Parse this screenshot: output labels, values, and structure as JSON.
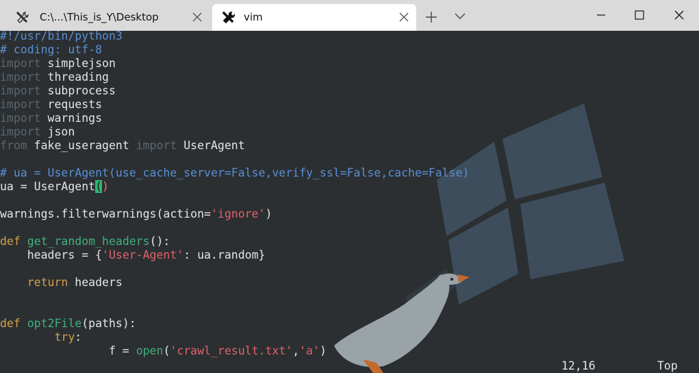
{
  "window": {
    "tabs": [
      {
        "label": "C:\\...\\This_is_Y\\Desktop",
        "icon": "tools-icon",
        "active": false
      },
      {
        "label": "vim",
        "icon": "tools-icon",
        "active": true
      }
    ]
  },
  "editor": {
    "lines": [
      {
        "parts": [
          {
            "t": "#!/usr/bin/python3",
            "c": "comment"
          }
        ]
      },
      {
        "parts": [
          {
            "t": "# coding: utf-8",
            "c": "comment"
          }
        ]
      },
      {
        "parts": [
          {
            "t": "import",
            "c": "kw"
          },
          {
            "t": " simplejson",
            "c": "op"
          }
        ]
      },
      {
        "parts": [
          {
            "t": "import",
            "c": "kw"
          },
          {
            "t": " threading",
            "c": "op"
          }
        ]
      },
      {
        "parts": [
          {
            "t": "import",
            "c": "kw"
          },
          {
            "t": " subprocess",
            "c": "op"
          }
        ]
      },
      {
        "parts": [
          {
            "t": "import",
            "c": "kw"
          },
          {
            "t": " requests",
            "c": "op"
          }
        ]
      },
      {
        "parts": [
          {
            "t": "import",
            "c": "kw"
          },
          {
            "t": " warnings",
            "c": "op"
          }
        ]
      },
      {
        "parts": [
          {
            "t": "import",
            "c": "kw"
          },
          {
            "t": " json",
            "c": "op"
          }
        ]
      },
      {
        "parts": [
          {
            "t": "from",
            "c": "kw"
          },
          {
            "t": " fake_useragent ",
            "c": "op"
          },
          {
            "t": "import",
            "c": "kw"
          },
          {
            "t": " UserAgent",
            "c": "op"
          }
        ]
      },
      {
        "parts": []
      },
      {
        "parts": [
          {
            "t": "# ua = UserAgent(use_cache_server=False,verify_ssl=False,cache=False)",
            "c": "comment"
          }
        ]
      },
      {
        "parts": [
          {
            "t": "ua = UserAgent",
            "c": "op"
          },
          {
            "t": "(",
            "c": "paren-hl"
          },
          {
            "t": ")",
            "c": "paren-hl2"
          }
        ]
      },
      {
        "parts": []
      },
      {
        "parts": [
          {
            "t": "warnings.filterwarnings(action=",
            "c": "op"
          },
          {
            "t": "'ignore'",
            "c": "str"
          },
          {
            "t": ")",
            "c": "op"
          }
        ]
      },
      {
        "parts": []
      },
      {
        "parts": [
          {
            "t": "def",
            "c": "kw2"
          },
          {
            "t": " ",
            "c": "op"
          },
          {
            "t": "get_random_headers",
            "c": "fn"
          },
          {
            "t": "():",
            "c": "op"
          }
        ]
      },
      {
        "parts": [
          {
            "t": "    headers = {",
            "c": "op"
          },
          {
            "t": "'User-Agent'",
            "c": "str"
          },
          {
            "t": ": ua.random}",
            "c": "op"
          }
        ]
      },
      {
        "parts": []
      },
      {
        "parts": [
          {
            "t": "    ",
            "c": "op"
          },
          {
            "t": "return",
            "c": "kw2"
          },
          {
            "t": " headers",
            "c": "op"
          }
        ]
      },
      {
        "parts": []
      },
      {
        "parts": []
      },
      {
        "parts": [
          {
            "t": "def",
            "c": "kw2"
          },
          {
            "t": " ",
            "c": "op"
          },
          {
            "t": "opt2File",
            "c": "fn"
          },
          {
            "t": "(paths):",
            "c": "op"
          }
        ]
      },
      {
        "parts": [
          {
            "t": "        ",
            "c": "op"
          },
          {
            "t": "try",
            "c": "kw2"
          },
          {
            "t": ":",
            "c": "op"
          }
        ]
      },
      {
        "parts": [
          {
            "t": "                f = ",
            "c": "op"
          },
          {
            "t": "open",
            "c": "fn"
          },
          {
            "t": "(",
            "c": "op"
          },
          {
            "t": "'crawl_result.txt'",
            "c": "str"
          },
          {
            "t": ",",
            "c": "op"
          },
          {
            "t": "'a'",
            "c": "str"
          },
          {
            "t": ")",
            "c": "op"
          }
        ]
      }
    ]
  },
  "status": {
    "position": "12,16",
    "scroll": "Top"
  },
  "colors": {
    "background": "#2b2f31",
    "comment": "#5b8fd6",
    "keyword": "#5b6670",
    "statement": "#d4a14a",
    "function": "#3fb27f",
    "string": "#e0626a"
  }
}
